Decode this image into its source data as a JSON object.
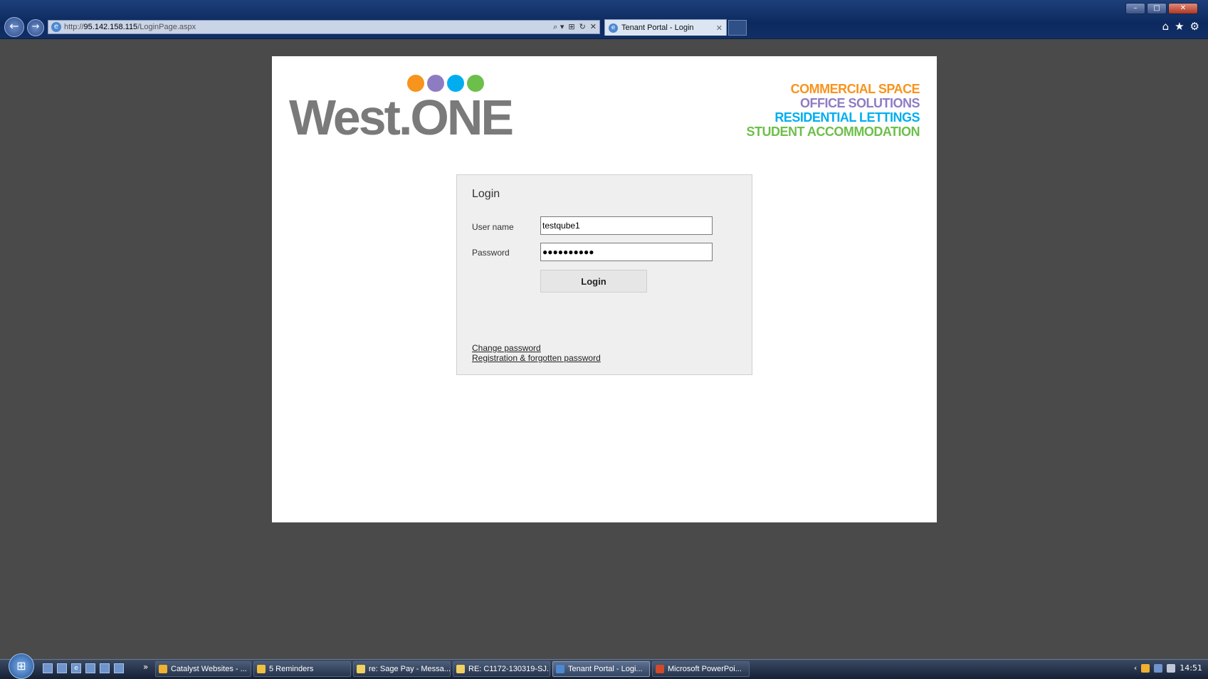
{
  "browser": {
    "address": {
      "scheme": "http://",
      "host": "95.142.158.115",
      "path": "/LoginPage.aspx",
      "tools": [
        "⌕ ▾",
        "⊞",
        "↻",
        "✕"
      ]
    },
    "tab": {
      "title": "Tenant Portal - Login",
      "close": "✕"
    },
    "window_controls": [
      "–",
      "□",
      "✕"
    ],
    "nav": {
      "back": "←",
      "forward": "→"
    },
    "right_icons": [
      "⌂",
      "★",
      "⚙"
    ]
  },
  "brand": {
    "name": "West.ONE",
    "dot_colors": [
      "#f7941d",
      "#8e7cc3",
      "#00aeef",
      "#6cbf4a"
    ],
    "services": [
      {
        "label": "COMMERCIAL SPACE",
        "color": "#f7941d"
      },
      {
        "label": "OFFICE SOLUTIONS",
        "color": "#8e7cc3"
      },
      {
        "label": "RESIDENTIAL LETTINGS",
        "color": "#00aeef"
      },
      {
        "label": "STUDENT ACCOMMODATION",
        "color": "#6cbf4a"
      }
    ]
  },
  "login": {
    "title": "Login",
    "username_label": "User name",
    "username_value": "testqube1",
    "password_label": "Password",
    "password_value": "●●●●●●●●●●",
    "button": "Login",
    "links": {
      "change_password": "Change password",
      "register": "Registration & forgotten password"
    }
  },
  "taskbar": {
    "items": [
      {
        "label": "Catalyst Websites - ...",
        "active": false,
        "icon_color": "#f0b030"
      },
      {
        "label": "5 Reminders",
        "active": false,
        "icon_color": "#f0c040"
      },
      {
        "label": "re: Sage Pay - Messa...",
        "active": false,
        "icon_color": "#f0d060"
      },
      {
        "label": "RE: C1172-130319-SJ...",
        "active": false,
        "icon_color": "#f0d060"
      },
      {
        "label": "Tenant Portal - Logi...",
        "active": true,
        "icon_color": "#4d88d0"
      },
      {
        "label": "Microsoft PowerPoi...",
        "active": false,
        "icon_color": "#d04a2a"
      }
    ],
    "clock": "14:51"
  }
}
